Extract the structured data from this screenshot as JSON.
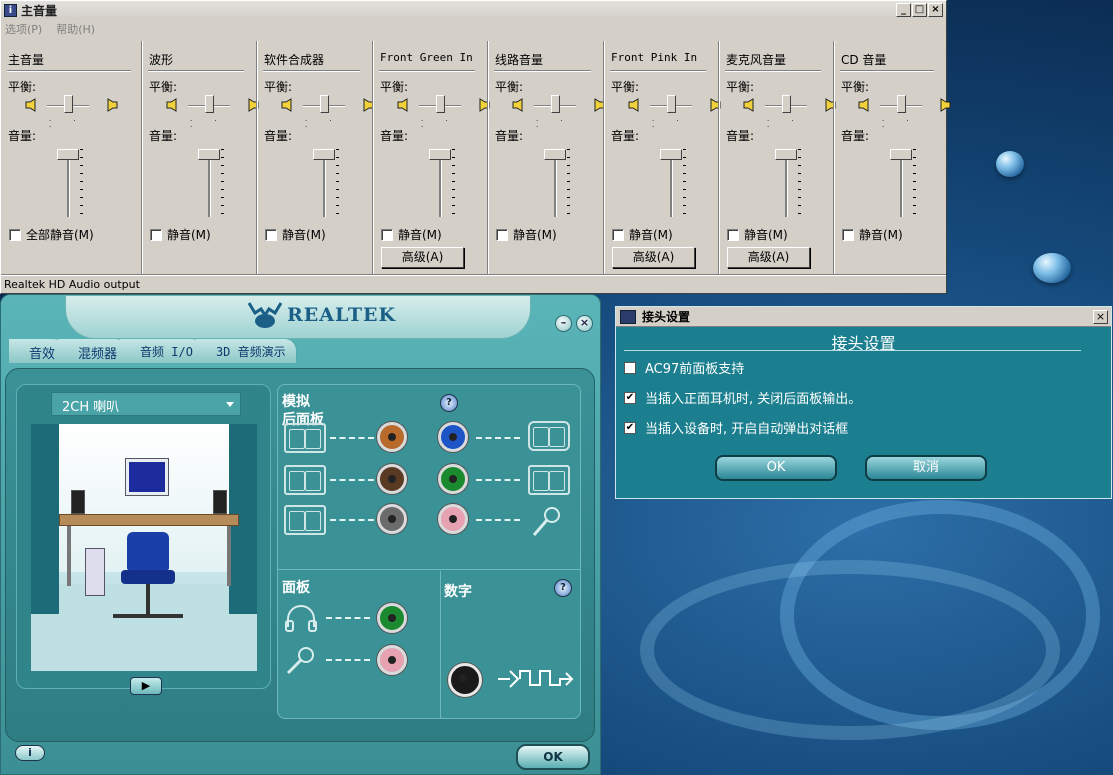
{
  "volume_window": {
    "title": "主音量",
    "menu": [
      "选项(P)",
      "帮助(H)"
    ],
    "balance_label": "平衡:",
    "volume_label": "音量:",
    "advanced_label": "高级(A)",
    "status": "Realtek HD Audio output",
    "channels": [
      {
        "name": "主音量",
        "mute": "全部静音(M)",
        "volume": 1.0,
        "balance": 0.5,
        "advanced": false
      },
      {
        "name": "波形",
        "mute": "静音(M)",
        "volume": 1.0,
        "balance": 0.5,
        "advanced": false
      },
      {
        "name": "软件合成器",
        "mute": "静音(M)",
        "volume": 1.0,
        "balance": 0.5,
        "advanced": false
      },
      {
        "name": "Front Green In",
        "mute": "静音(M)",
        "volume": 1.0,
        "balance": 0.5,
        "advanced": true
      },
      {
        "name": "线路音量",
        "mute": "静音(M)",
        "volume": 1.0,
        "balance": 0.5,
        "advanced": false
      },
      {
        "name": "Front Pink In",
        "mute": "静音(M)",
        "volume": 1.0,
        "balance": 0.5,
        "advanced": true
      },
      {
        "name": "麦克风音量",
        "mute": "静音(M)",
        "volume": 1.0,
        "balance": 0.5,
        "advanced": true
      },
      {
        "name": "CD 音量",
        "mute": "静音(M)",
        "volume": 1.0,
        "balance": 0.5,
        "advanced": false
      }
    ]
  },
  "realtek": {
    "brand": "REALTEK",
    "tabs": [
      "音效",
      "混频器",
      "音频 I/O",
      "3D 音频演示"
    ],
    "speaker_config": "2CH 喇叭",
    "analog_title": "模拟",
    "rear_panel_title": "后面板",
    "front_panel_title": "面板",
    "digital_title": "数字",
    "ok_label": "OK",
    "info_label": "i",
    "rear_jacks": [
      {
        "color": "#b86a2a",
        "device": "speakers"
      },
      {
        "color": "#5a3a22",
        "device": "speakers"
      },
      {
        "color": "#6b6b6b",
        "device": "speakers"
      },
      {
        "color": "#1d55c7",
        "device": "line-in"
      },
      {
        "color": "#1b8a2e",
        "device": "speakers"
      },
      {
        "color": "#e7a2b2",
        "device": "microphone"
      }
    ],
    "front_jacks": [
      {
        "color": "#1b8a2e",
        "device": "headphones"
      },
      {
        "color": "#e7a2b2",
        "device": "microphone"
      }
    ]
  },
  "connector_dialog": {
    "window_title": "接头设置",
    "heading": "接头设置",
    "options": [
      {
        "label": "AC97前面板支持",
        "checked": false
      },
      {
        "label": "当插入正面耳机时, 关闭后面板输出。",
        "checked": true
      },
      {
        "label": "当插入设备时, 开启自动弹出对话框",
        "checked": true
      }
    ],
    "ok_label": "OK",
    "cancel_label": "取消"
  }
}
